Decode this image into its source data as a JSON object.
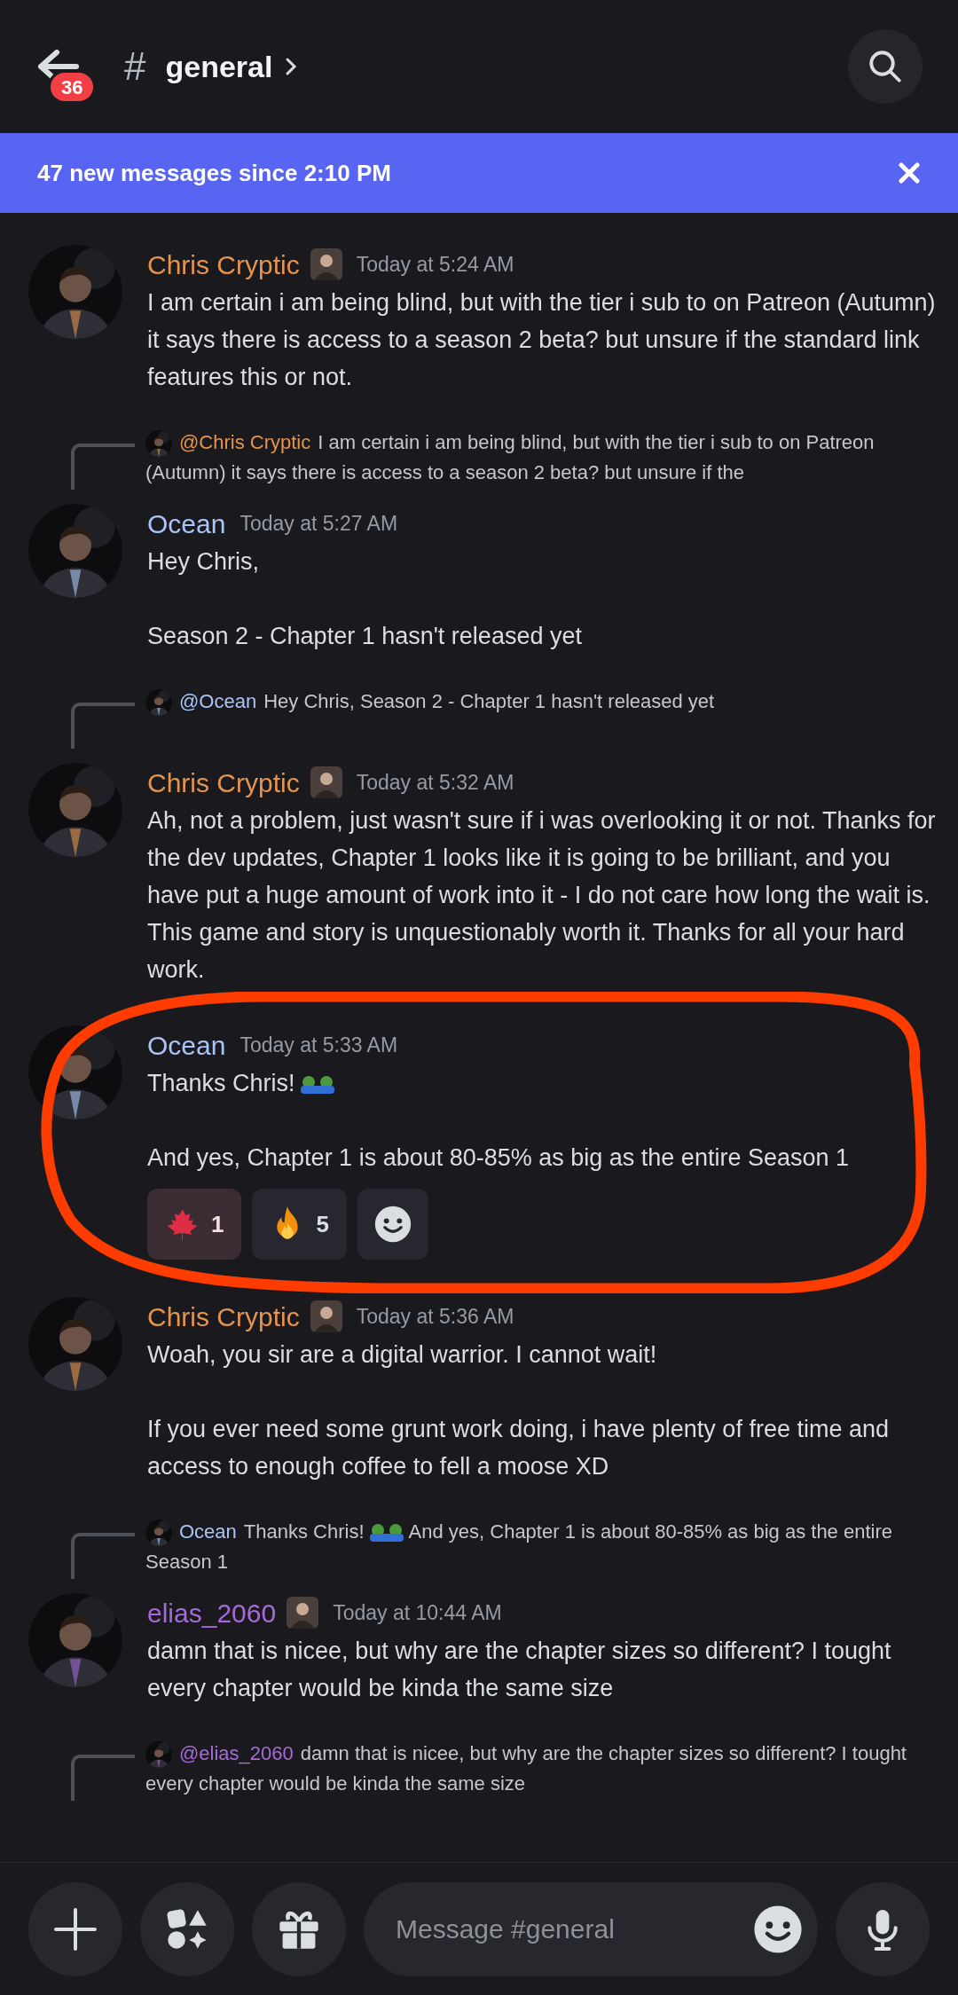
{
  "header": {
    "back_badge": "36",
    "channel_symbol": "#",
    "channel": "general"
  },
  "banner": {
    "text": "47 new messages since 2:10 PM"
  },
  "messages": [
    {
      "author": "Chris Cryptic",
      "color": "#e3944d",
      "badge": true,
      "circled": false,
      "time": "Today at 5:24 AM",
      "paragraphs": [
        [
          {
            "kind": "text",
            "text": "I am certain i am being blind, but with the tier i sub to on Patreon (Autumn) it says there is access to a  season 2 beta? but unsure if the standard link features this or not."
          }
        ]
      ]
    },
    {
      "reply": {
        "mention": "@Chris Cryptic",
        "color": "#e3944d",
        "parts": [
          {
            "kind": "text",
            "text": "I am certain i am being blind, but with the tier i sub to on Patreon (Autumn) it says there is access to a  season 2 beta? but unsure if the"
          }
        ]
      },
      "author": "Ocean",
      "color": "#a9c4f5",
      "badge": false,
      "circled": false,
      "time": "Today at 5:27 AM",
      "paragraphs": [
        [
          {
            "kind": "text",
            "text": "Hey Chris,"
          }
        ],
        [
          {
            "kind": "text",
            "text": "Season 2 - Chapter 1 hasn't released yet"
          }
        ]
      ]
    },
    {
      "reply": {
        "mention": "@Ocean",
        "color": "#a9c4f5",
        "parts": [
          {
            "kind": "text",
            "text": "Hey Chris,   Season 2 - Chapter 1 hasn't released yet"
          }
        ]
      },
      "author": "Chris Cryptic",
      "color": "#e3944d",
      "badge": true,
      "circled": false,
      "time": "Today at 5:32 AM",
      "paragraphs": [
        [
          {
            "kind": "text",
            "text": "Ah, not a problem, just wasn't sure if i was overlooking it or not. Thanks for the dev updates, Chapter 1 looks like it is going to be brilliant, and you have put a huge amount of work into it - I do not care how long the wait is. This game and story is unquestionably worth it. Thanks for all your hard work."
          }
        ]
      ]
    },
    {
      "author": "Ocean",
      "color": "#a9c4f5",
      "badge": false,
      "circled": true,
      "time": "Today at 5:33 AM",
      "paragraphs": [
        [
          {
            "kind": "text",
            "text": "Thanks Chris!"
          },
          {
            "kind": "emoji"
          }
        ],
        [
          {
            "kind": "text",
            "text": "And yes, Chapter 1 is about 80-85% as big as the entire Season 1"
          }
        ]
      ],
      "reactions": [
        {
          "kind": "maple",
          "count": "1",
          "selected": true
        },
        {
          "kind": "fire",
          "count": "5",
          "selected": false
        }
      ]
    },
    {
      "author": "Chris Cryptic",
      "color": "#e3944d",
      "badge": true,
      "circled": false,
      "time": "Today at 5:36 AM",
      "paragraphs": [
        [
          {
            "kind": "text",
            "text": "Woah, you sir are a digital warrior. I cannot wait!"
          }
        ],
        [
          {
            "kind": "text",
            "text": "If you ever need some grunt work doing, i have plenty of free time and access to enough coffee to fell a moose XD"
          }
        ]
      ]
    },
    {
      "reply": {
        "mention": "Ocean",
        "color": "#a9c4f5",
        "parts": [
          {
            "kind": "text",
            "text": "Thanks Chris!"
          },
          {
            "kind": "emoji"
          },
          {
            "kind": "text",
            "text": "And yes, Chapter 1 is about 80-85% as big as the entire Season 1"
          }
        ]
      },
      "author": "elias_2060",
      "color": "#a46ad6",
      "badge": true,
      "circled": false,
      "time": "Today at 10:44 AM",
      "paragraphs": [
        [
          {
            "kind": "text",
            "text": "damn that is nicee, but why are the chapter sizes so different? I tought every chapter would be kinda the same size"
          }
        ]
      ]
    }
  ],
  "pending_reply": {
    "mention": "@elias_2060",
    "color": "#a46ad6",
    "parts": [
      {
        "kind": "text",
        "text": "damn that is nicee, but why are the chapter sizes so different? I tought every chapter would be kinda the same size"
      }
    ]
  },
  "composer": {
    "placeholder": "Message #general"
  }
}
